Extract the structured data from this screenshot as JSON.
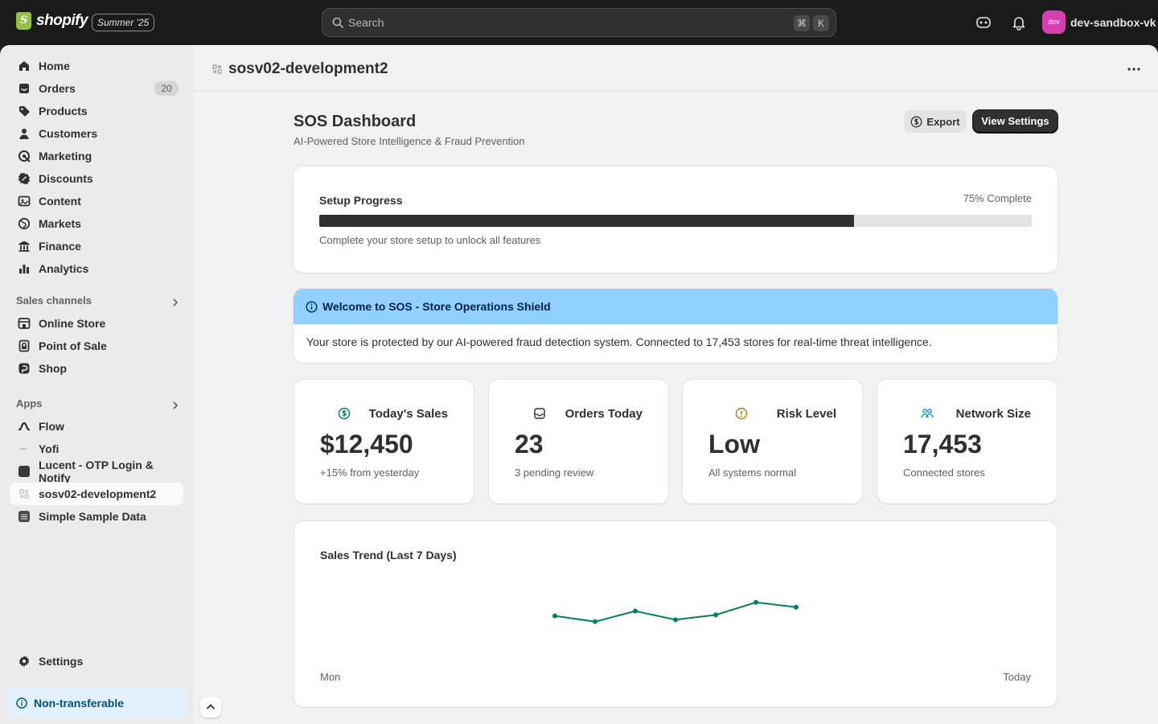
{
  "topbar": {
    "brand": "shopify",
    "edition": "Summer '25",
    "search_placeholder": "Search",
    "shortcut_key1": "⌘",
    "shortcut_key2": "K",
    "avatar_text": "dev",
    "account_name": "dev-sandbox-vk"
  },
  "sidebar": {
    "main_items": [
      {
        "label": "Home",
        "icon": "home-icon"
      },
      {
        "label": "Orders",
        "icon": "inbox-icon",
        "badge": "20"
      },
      {
        "label": "Products",
        "icon": "tag-icon"
      },
      {
        "label": "Customers",
        "icon": "person-icon"
      },
      {
        "label": "Marketing",
        "icon": "target-icon"
      },
      {
        "label": "Discounts",
        "icon": "discount-icon"
      },
      {
        "label": "Content",
        "icon": "content-icon"
      },
      {
        "label": "Markets",
        "icon": "globe-icon"
      },
      {
        "label": "Finance",
        "icon": "bank-icon"
      },
      {
        "label": "Analytics",
        "icon": "bar-chart-icon"
      }
    ],
    "sales_channels_label": "Sales channels",
    "sales_channels": [
      {
        "label": "Online Store",
        "icon": "store-icon"
      },
      {
        "label": "Point of Sale",
        "icon": "pos-icon"
      },
      {
        "label": "Shop",
        "icon": "shop-icon"
      }
    ],
    "apps_label": "Apps",
    "apps": [
      {
        "label": "Flow",
        "icon": "flow-icon"
      },
      {
        "label": "Yofi",
        "icon": "dots-icon"
      },
      {
        "label": "Lucent - OTP Login & Notify",
        "icon": "app-square-icon"
      },
      {
        "label": "sosv02-development2",
        "icon": "app-grid-icon",
        "active": true
      },
      {
        "label": "Simple Sample Data",
        "icon": "stack-icon"
      }
    ],
    "settings_label": "Settings",
    "nontransferable_label": "Non-transferable"
  },
  "app_header": {
    "title": "sosv02-development2"
  },
  "page": {
    "title": "SOS Dashboard",
    "subtitle": "AI-Powered Store Intelligence & Fraud Prevention",
    "export_label": "Export",
    "settings_label": "View Settings"
  },
  "setup": {
    "title": "Setup Progress",
    "percent_text": "75% Complete",
    "progress": 0.75,
    "description": "Complete your store setup to unlock all features"
  },
  "banner": {
    "title": "Welcome to SOS - Store Operations Shield",
    "body": "Your store is protected by our AI-powered fraud detection system. Connected to 17,453 stores for real-time threat intelligence."
  },
  "stats": [
    {
      "label": "Today's Sales",
      "value": "$12,450",
      "sub": "+15% from yesterday",
      "icon": "dollar-icon",
      "color": "#008060"
    },
    {
      "label": "Orders Today",
      "value": "23",
      "sub": "3 pending review",
      "icon": "inbox-icon",
      "color": "#303030"
    },
    {
      "label": "Risk Level",
      "value": "Low",
      "sub": "All systems normal",
      "icon": "alert-circle-icon",
      "color": "#b28400"
    },
    {
      "label": "Network Size",
      "value": "17,453",
      "sub": "Connected stores",
      "icon": "people-icon",
      "color": "#0094d5"
    }
  ],
  "chart_data": {
    "type": "line",
    "title": "Sales Trend (Last 7 Days)",
    "x_start_label": "Mon",
    "x_end_label": "Today",
    "values": [
      52,
      46,
      57,
      48,
      53,
      66,
      61
    ],
    "ylim": [
      0,
      100
    ],
    "line_color": "#008060"
  },
  "colors": {
    "topbar": "#1a1a1a",
    "accent_dark": "#303030",
    "banner": "#91d0ff",
    "success": "#008060"
  }
}
